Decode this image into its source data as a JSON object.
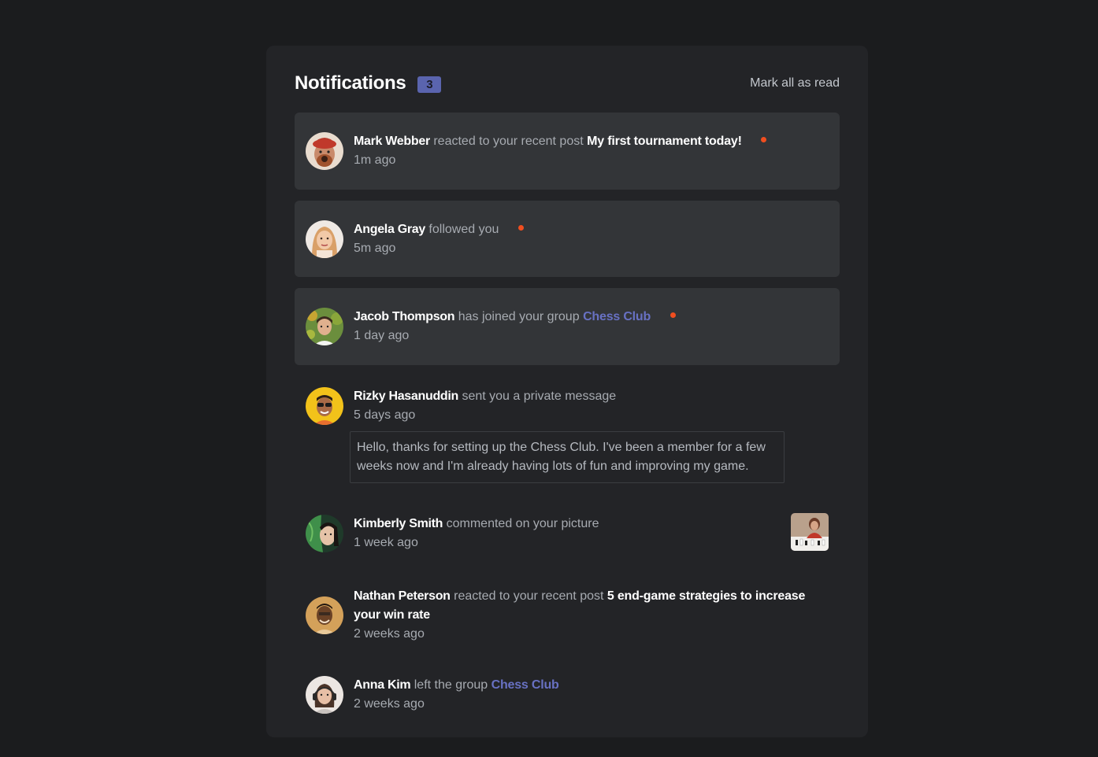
{
  "header": {
    "title": "Notifications",
    "count": "3",
    "mark_all": "Mark all as read"
  },
  "notifications": [
    {
      "name": "Mark Webber",
      "action": "reacted to your recent post",
      "post": "My first tournament today!",
      "time": "1m ago",
      "unread": true
    },
    {
      "name": "Angela Gray",
      "action": "followed you",
      "time": "5m ago",
      "unread": true
    },
    {
      "name": "Jacob Thompson",
      "action": "has joined your group",
      "group": "Chess Club",
      "time": "1 day ago",
      "unread": true
    },
    {
      "name": "Rizky Hasanuddin",
      "action": "sent you a private message",
      "time": "5 days ago",
      "message": "Hello, thanks for setting up the Chess Club. I've been a member for a few weeks now and I'm already having lots of fun and improving my game.",
      "unread": false
    },
    {
      "name": "Kimberly Smith",
      "action": "commented on your picture",
      "time": "1 week ago",
      "unread": false
    },
    {
      "name": "Nathan Peterson",
      "action": "reacted to your recent post",
      "post": "5 end-game strategies to increase your win rate",
      "time": "2 weeks ago",
      "unread": false
    },
    {
      "name": "Anna Kim",
      "action": "left the group",
      "group": "Chess Club",
      "time": "2 weeks ago",
      "unread": false
    }
  ],
  "colors": {
    "unread_dot": "#f04e1f",
    "accent": "#6871c3",
    "badge": "#5a64ae"
  }
}
